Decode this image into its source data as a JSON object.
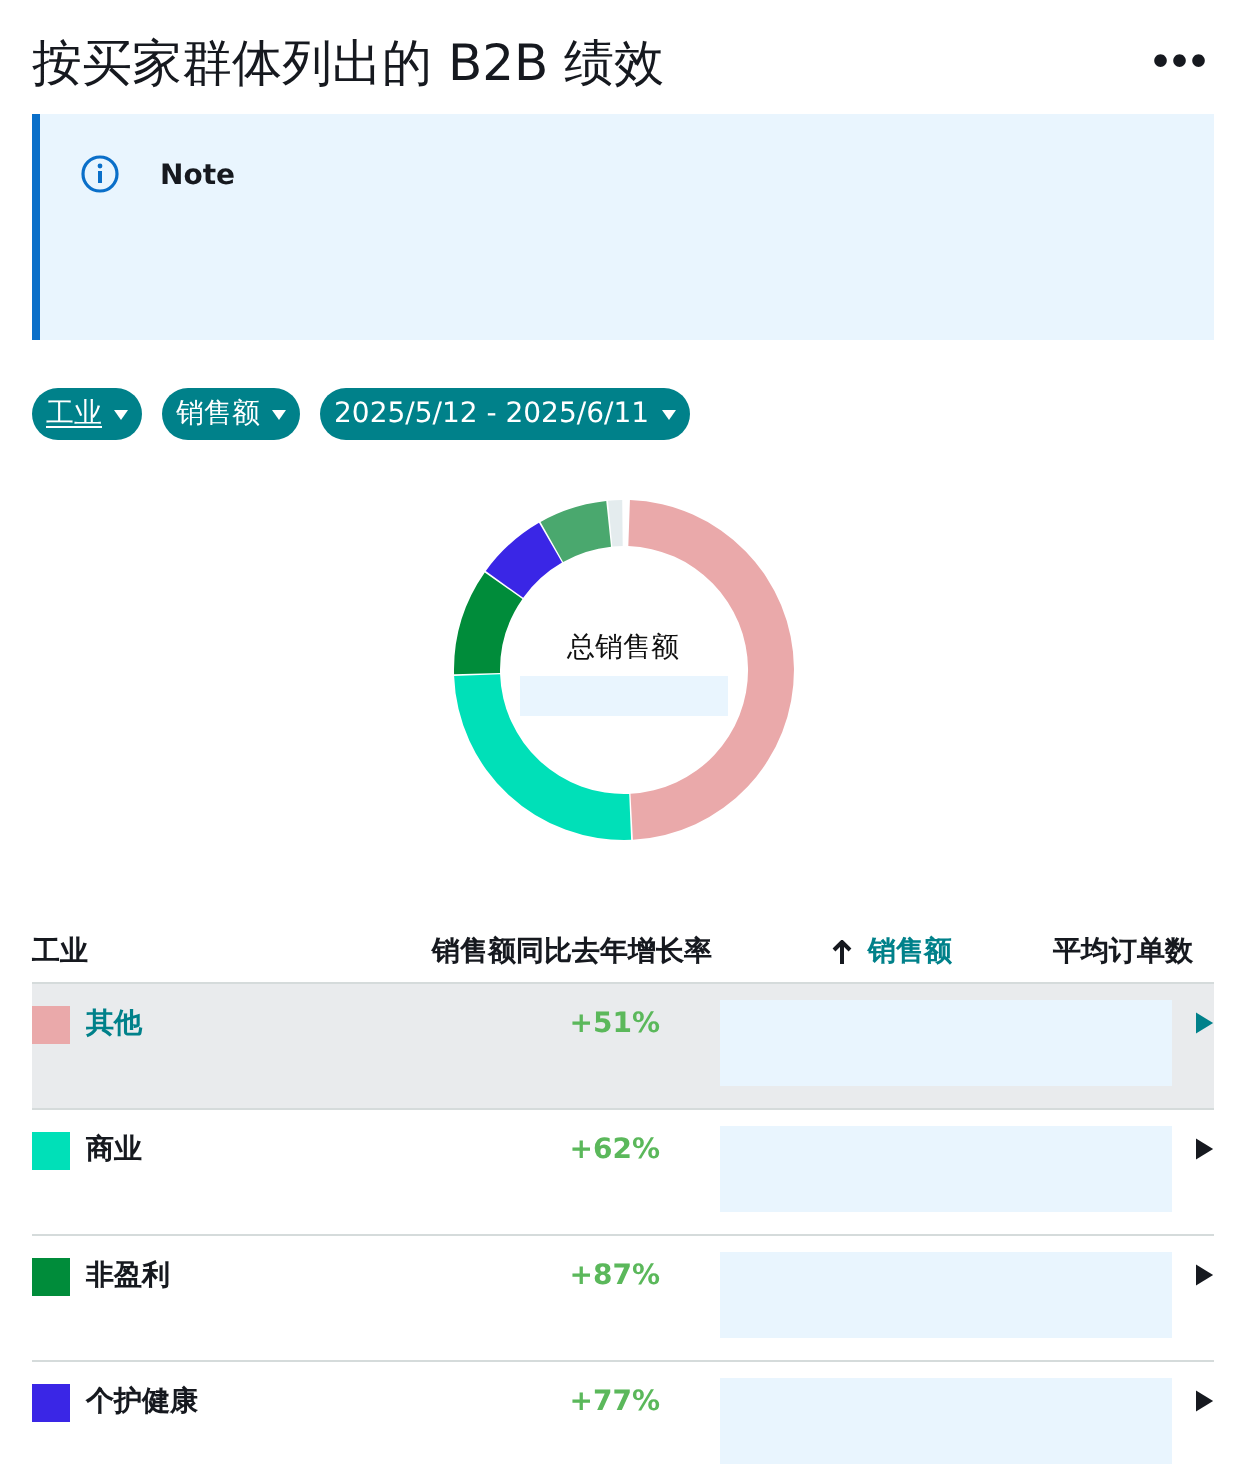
{
  "title": "按买家群体列出的 B2B 绩效",
  "menu_button": "•••",
  "note": {
    "title": "Note"
  },
  "filters": [
    {
      "label": "工业",
      "underlined": true
    },
    {
      "label": "销售额",
      "underlined": false
    },
    {
      "label": "2025/5/12 - 2025/6/11",
      "underlined": false
    }
  ],
  "donut": {
    "center_label": "总销售额"
  },
  "table": {
    "columns": [
      {
        "label": "工业",
        "sorted": false
      },
      {
        "label": "销售额同比去年增长率",
        "sorted": false
      },
      {
        "label": "销售额",
        "sorted": true
      },
      {
        "label": "平均订单数",
        "sorted": false
      }
    ],
    "rows": [
      {
        "name": "其他",
        "color": "#eaa9aa",
        "growth": "+51%",
        "selected": true
      },
      {
        "name": "商业",
        "color": "#00e0b8",
        "growth": "+62%",
        "selected": false
      },
      {
        "name": "非盈利",
        "color": "#008c3a",
        "growth": "+87%",
        "selected": false
      },
      {
        "name": "个护健康",
        "color": "#3a26e6",
        "growth": "+77%",
        "selected": false
      }
    ]
  }
}
